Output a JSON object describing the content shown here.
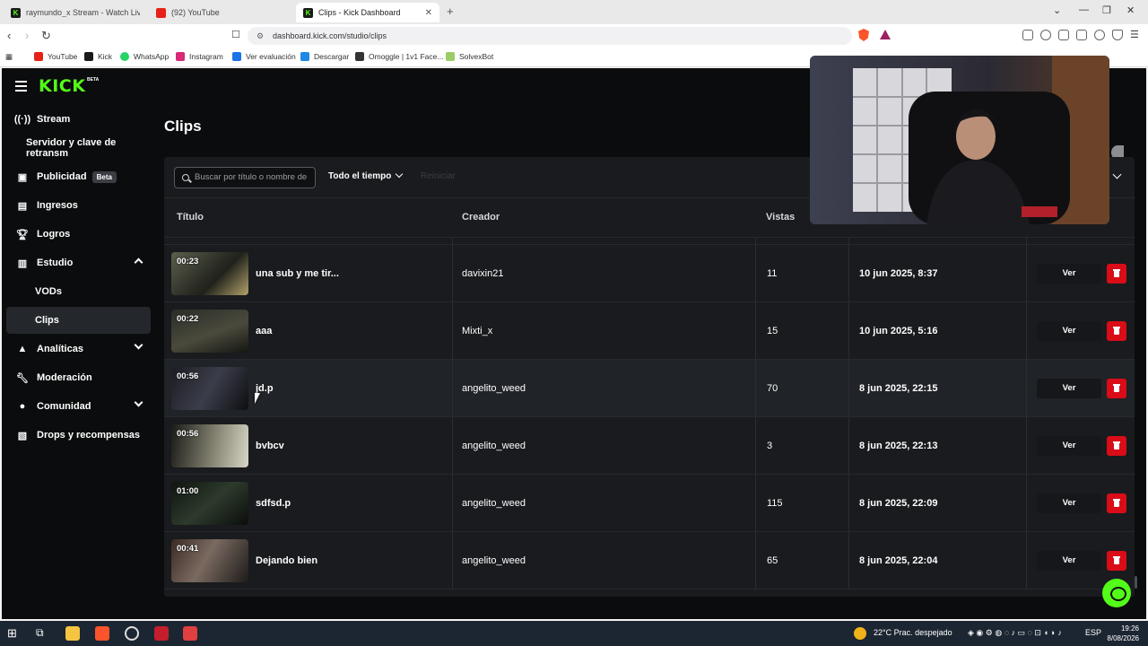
{
  "browser": {
    "tabs": [
      {
        "title": "raymundo_x Stream - Watch Live on",
        "favicon": "kick-icon"
      },
      {
        "title": "(92) YouTube",
        "favicon": "youtube-icon"
      },
      {
        "title": "Clips - Kick Dashboard",
        "favicon": "kick-icon",
        "active": true
      }
    ],
    "url": "dashboard.kick.com/studio/clips",
    "bookmarks": [
      {
        "label": "YouTube",
        "color": "#e62117"
      },
      {
        "label": "Kick",
        "color": "#53fc18"
      },
      {
        "label": "WhatsApp",
        "color": "#25d366"
      },
      {
        "label": "Instagram",
        "color": "#d62976"
      },
      {
        "label": "Ver evaluación",
        "color": "#1a73e8"
      },
      {
        "label": "Descargar",
        "color": "#1e88e5"
      },
      {
        "label": "Omoggle | 1v1 Face...",
        "color": "#333333"
      },
      {
        "label": "SolvexBot",
        "color": "#9ccc65"
      }
    ]
  },
  "app": {
    "logo": "KICK",
    "logo_badge": "BETA",
    "accent": "#53fc18"
  },
  "sidebar": {
    "items": [
      {
        "label": "Stream",
        "icon": "broadcast-icon"
      },
      {
        "label": "Servidor y clave de retransm"
      },
      {
        "label": "Publicidad",
        "icon": "ad-icon",
        "badge": "Beta"
      },
      {
        "label": "Ingresos",
        "icon": "revenue-icon"
      },
      {
        "label": "Logros",
        "icon": "trophy-icon"
      },
      {
        "label": "Estudio",
        "icon": "studio-icon",
        "expanded": true
      },
      {
        "label": "VODs"
      },
      {
        "label": "Clips",
        "active": true
      },
      {
        "label": "Analíticas",
        "icon": "analytics-icon"
      },
      {
        "label": "Moderación",
        "icon": "wrench-icon"
      },
      {
        "label": "Comunidad",
        "icon": "community-icon"
      },
      {
        "label": "Drops y recompensas",
        "icon": "gift-icon"
      }
    ]
  },
  "main": {
    "title": "Clips",
    "search_placeholder": "Buscar por título o nombre de",
    "time_filter": "Todo el tiempo",
    "reset_label": "Reiniciar",
    "columns": [
      "Título",
      "Creador",
      "Vistas"
    ],
    "rows": [
      {
        "duration": "00:23",
        "title": "una sub y me tir...",
        "creator": "davixin21",
        "views": "11",
        "date": "10 jun 2025, 8:37",
        "action": "Ver"
      },
      {
        "duration": "00:22",
        "title": "aaa",
        "creator": "Mixti_x",
        "views": "15",
        "date": "10 jun 2025, 5:16",
        "action": "Ver"
      },
      {
        "duration": "00:56",
        "title": "jd.p",
        "creator": "angelito_weed",
        "views": "70",
        "date": "8 jun 2025, 22:15",
        "action": "Ver"
      },
      {
        "duration": "00:56",
        "title": "bvbcv",
        "creator": "angelito_weed",
        "views": "3",
        "date": "8 jun 2025, 22:13",
        "action": "Ver"
      },
      {
        "duration": "01:00",
        "title": "sdfsd.p",
        "creator": "angelito_weed",
        "views": "115",
        "date": "8 jun 2025, 22:09",
        "action": "Ver"
      },
      {
        "duration": "00:41",
        "title": "Dejando bien",
        "creator": "angelito_weed",
        "views": "65",
        "date": "8 jun 2025, 22:04",
        "action": "Ver"
      }
    ]
  },
  "taskbar": {
    "weather": "22°C  Prac. despejado",
    "lang": "ESP",
    "time": "19:26",
    "date": "8/08/2026"
  }
}
